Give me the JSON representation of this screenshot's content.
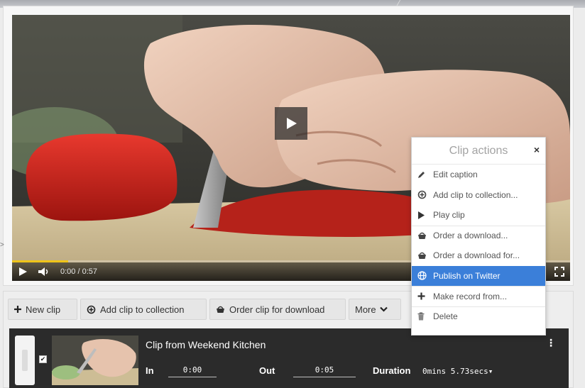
{
  "video": {
    "time_display": "0:00 / 0:57",
    "progress_fraction": 0.1
  },
  "clip_actions_menu": {
    "title": "Clip actions",
    "close_label": "×",
    "items": [
      {
        "label": "Edit caption",
        "icon": "pencil-icon"
      },
      {
        "label": "Add clip to collection...",
        "icon": "collection-icon"
      },
      {
        "label": "Play clip",
        "icon": "play-icon"
      },
      {
        "label": "Order a download...",
        "icon": "basket-icon"
      },
      {
        "label": "Order a download for...",
        "icon": "basket-icon"
      },
      {
        "label": "Publish on Twitter",
        "icon": "globe-icon"
      },
      {
        "label": "Make record from...",
        "icon": "plus-icon"
      },
      {
        "label": "Delete",
        "icon": "trash-icon"
      }
    ],
    "active_index": 5
  },
  "toolbar": {
    "new_clip": "New clip",
    "add_to_collection": "Add clip to collection",
    "order_for_download": "Order clip for download",
    "more": "More"
  },
  "clip": {
    "title": "Clip from Weekend Kitchen",
    "in_label": "In",
    "in_value": "0:00",
    "out_label": "Out",
    "out_value": "0:05",
    "duration_label": "Duration",
    "duration_value": "0mins 5.73secs▾",
    "checked_mark": "✔"
  },
  "colors": {
    "accent": "#3b7fd9",
    "progress": "#f0c419",
    "clip_row_bg": "#2b2b2b"
  }
}
